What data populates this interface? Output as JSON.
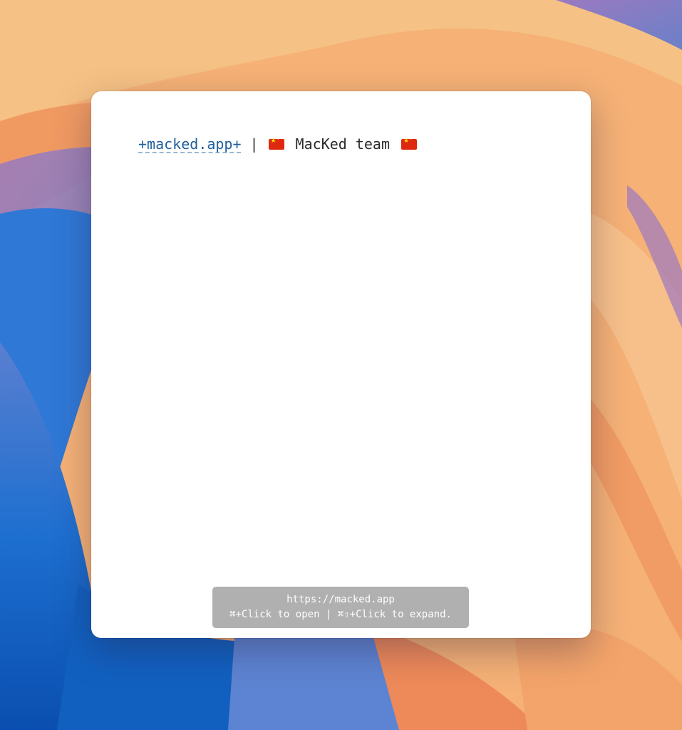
{
  "window": {
    "link_text": "+macked.app+",
    "separator": "|",
    "team_name": "MacKed team",
    "flag_icon": "china-flag-icon"
  },
  "tooltip": {
    "url": "https://macked.app",
    "hint": "⌘+Click to open | ⌘⇧+Click to expand."
  },
  "colors": {
    "link": "#1f5f9a",
    "text": "#2b2b2b",
    "tooltip_bg": "#969696",
    "flag_red": "#de2910",
    "flag_yellow": "#ffde00"
  }
}
